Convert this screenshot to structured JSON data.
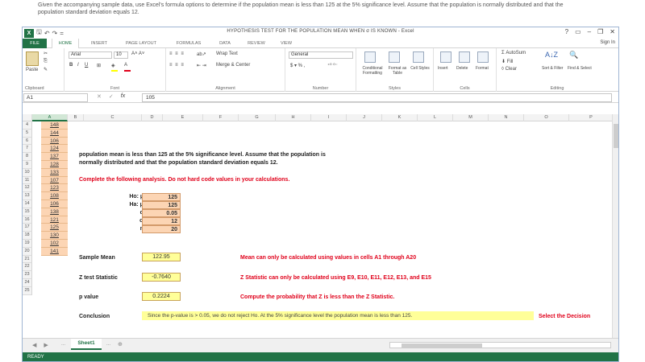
{
  "question": {
    "line1": "Given the accompanying sample data, use Excel's formula options to determine if the population mean is less than 125 at the 5% significance level. Assume that the population is normally distributed and that the",
    "line2": "population standard deviation equals 12."
  },
  "titlebar": {
    "title": "HYPOTHESIS TEST FOR THE POPULATION MEAN WHEN σ IS KNOWN - Excel",
    "help": "?",
    "minimize": "–",
    "restore": "❐",
    "close": "✕"
  },
  "tabs": [
    "FILE",
    "HOME",
    "INSERT",
    "PAGE LAYOUT",
    "FORMULAS",
    "DATA",
    "REVIEW",
    "VIEW"
  ],
  "signin": "Sign In",
  "ribbon": {
    "paste": "Paste",
    "clipboard": "Clipboard",
    "font_name": "Arial",
    "font_size": "10",
    "font": "Font",
    "wrap_text": "Wrap Text",
    "merge_center": "Merge & Center",
    "alignment": "Alignment",
    "number_format": "General",
    "number": "Number",
    "conditional_formatting": "Conditional Formatting",
    "format_as_table": "Format as Table",
    "cell_styles": "Cell Styles",
    "styles": "Styles",
    "insert": "Insert",
    "delete": "Delete",
    "format": "Format",
    "cells": "Cells",
    "autosum": "AutoSum",
    "fill": "Fill",
    "clear": "Clear",
    "sort_filter": "Sort & Filter",
    "find_select": "Find & Select",
    "editing": "Editing",
    "accent": "#217346"
  },
  "formula_bar": {
    "name_box": "A1",
    "fx": "fx",
    "formula": "105"
  },
  "columns": [
    "A",
    "B",
    "C",
    "D",
    "E",
    "F",
    "G",
    "H",
    "I",
    "J",
    "K",
    "L",
    "M",
    "N",
    "O",
    "P",
    "Q",
    "R"
  ],
  "rows": [
    "4",
    "5",
    "6",
    "7",
    "8",
    "9",
    "10",
    "11",
    "12",
    "13",
    "14",
    "15",
    "16",
    "17",
    "18",
    "19",
    "20",
    "21",
    "22",
    "23",
    "24",
    "25"
  ],
  "column_a": [
    "148",
    "144",
    "106",
    "124",
    "137",
    "128",
    "133",
    "107",
    "123",
    "108",
    "106",
    "138",
    "121",
    "125",
    "130",
    "102",
    "141"
  ],
  "sheet": {
    "intro1": "population mean is less than 125 at the 5% significance level. Assume that the population is",
    "intro2": "normally distributed and that the population standard deviation equals 12.",
    "instruction": "Complete the following analysis. Do not hard code values in your calculations.",
    "h0_label": "Ho: μ ≥",
    "ha_label": "Ha: μ <",
    "alpha_label": "α =",
    "sigma_label": "σ =",
    "n_label": "n =",
    "h0_value": "125",
    "ha_value": "125",
    "alpha_value": "0.05",
    "sigma_value": "12",
    "n_value": "20",
    "sample_mean_label": "Sample Mean",
    "sample_mean_value": "122.95",
    "sample_mean_note": "Mean can only be calculated using values in cells A1 through A20",
    "z_label": "Z test  Statistic",
    "z_value": "-0.7640",
    "z_note": "Z Statistic can only be calculated using E9, E10, E11, E12, E13, and E15",
    "p_label": "p value",
    "p_value": "0.2224",
    "p_note": "Compute the probability that Z is less than the Z Statistic.",
    "conclusion_label": "Conclusion",
    "conclusion_text": "Since the p-value is > 0.05, we do not reject Ho.  At the 5% significance level the population mean is less than 125.",
    "select_decision": "Select the Decision"
  },
  "sheet_tabs": {
    "active": "Sheet1",
    "more": "...",
    "add": "⊕"
  },
  "status": "READY"
}
